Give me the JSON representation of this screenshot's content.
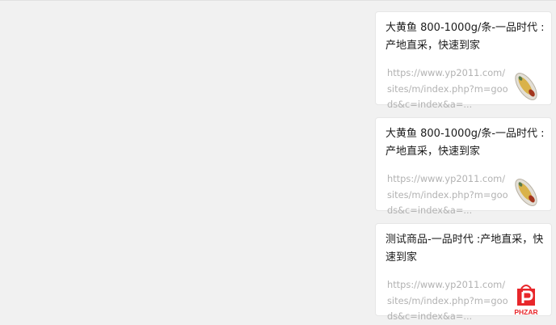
{
  "messages": [
    {
      "title": "大黄鱼 800-1000g/条-一品时代 :产地直采，快速到家",
      "url": "https://www.yp2011.com/sites/m/index.php?m=goods&c=index&a=...",
      "thumbnail": "fish-thumbnail"
    },
    {
      "title": "大黄鱼 800-1000g/条-一品时代 :产地直采，快速到家",
      "url": "https://www.yp2011.com/sites/m/index.php?m=goods&c=index&a=...",
      "thumbnail": "fish-thumbnail"
    },
    {
      "title": "测试商品-一品时代 :产地直采，快速到家",
      "url": "https://www.yp2011.com/sites/m/index.php?m=goods&c=index&a=...",
      "thumbnail": "phzar-logo",
      "logo_text": "PHZAR"
    }
  ],
  "colors": {
    "background": "#f1f1f1",
    "card": "#ffffff",
    "title": "#1a1a1a",
    "url": "#b2b2b2",
    "logo_red": "#e8262a"
  }
}
